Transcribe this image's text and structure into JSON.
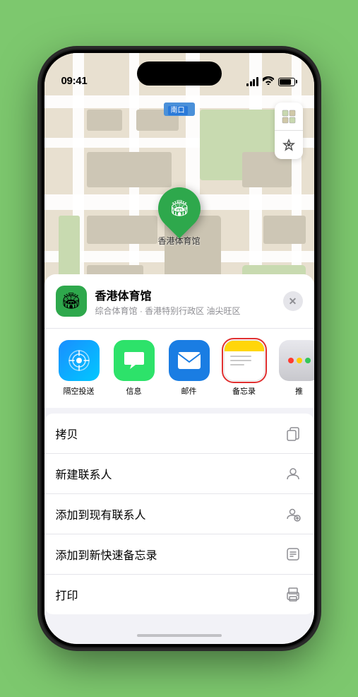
{
  "status_bar": {
    "time": "09:41",
    "location_arrow": "▶"
  },
  "map": {
    "label": "南口",
    "pin_label": "香港体育馆"
  },
  "venue_card": {
    "name": "香港体育馆",
    "subtitle": "综合体育馆 · 香港特别行政区 油尖旺区",
    "close_label": "✕"
  },
  "share_items": [
    {
      "id": "airdrop",
      "label": "隔空投送",
      "icon": "📡"
    },
    {
      "id": "messages",
      "label": "信息",
      "icon": "💬"
    },
    {
      "id": "mail",
      "label": "邮件",
      "icon": "✉"
    },
    {
      "id": "notes",
      "label": "备忘录",
      "icon": ""
    },
    {
      "id": "more",
      "label": "推",
      "icon": ""
    }
  ],
  "action_items": [
    {
      "label": "拷贝",
      "icon": "copy"
    },
    {
      "label": "新建联系人",
      "icon": "person"
    },
    {
      "label": "添加到现有联系人",
      "icon": "person-add"
    },
    {
      "label": "添加到新快速备忘录",
      "icon": "memo"
    },
    {
      "label": "打印",
      "icon": "print"
    }
  ]
}
